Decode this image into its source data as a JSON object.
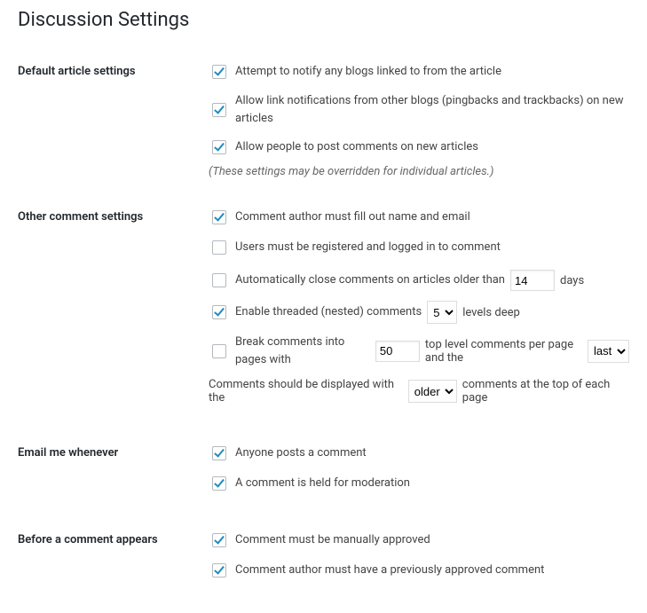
{
  "page_title": "Discussion Settings",
  "sections": {
    "default_article": {
      "heading": "Default article settings",
      "notify_blogs": "Attempt to notify any blogs linked to from the article",
      "allow_pingbacks": "Allow link notifications from other blogs (pingbacks and trackbacks) on new articles",
      "allow_comments": "Allow people to post comments on new articles",
      "note": "(These settings may be overridden for individual articles.)"
    },
    "other_comment": {
      "heading": "Other comment settings",
      "require_name_email": "Comment author must fill out name and email",
      "require_registration": "Users must be registered and logged in to comment",
      "auto_close_prefix": "Automatically close comments on articles older than",
      "auto_close_days_value": "14",
      "auto_close_suffix": "days",
      "threaded_prefix": "Enable threaded (nested) comments",
      "threaded_levels_value": "5",
      "threaded_suffix": "levels deep",
      "paginate_prefix": "Break comments into pages with",
      "paginate_perpage_value": "50",
      "paginate_mid": "top level comments per page and the",
      "paginate_default_page_value": "last",
      "order_prefix": "Comments should be displayed with the",
      "order_value": "older",
      "order_suffix": "comments at the top of each page"
    },
    "email_me": {
      "heading": "Email me whenever",
      "anyone_posts": "Anyone posts a comment",
      "held_moderation": "A comment is held for moderation"
    },
    "before_appears": {
      "heading": "Before a comment appears",
      "manual_approve": "Comment must be manually approved",
      "prev_approved": "Comment author must have a previously approved comment"
    }
  }
}
